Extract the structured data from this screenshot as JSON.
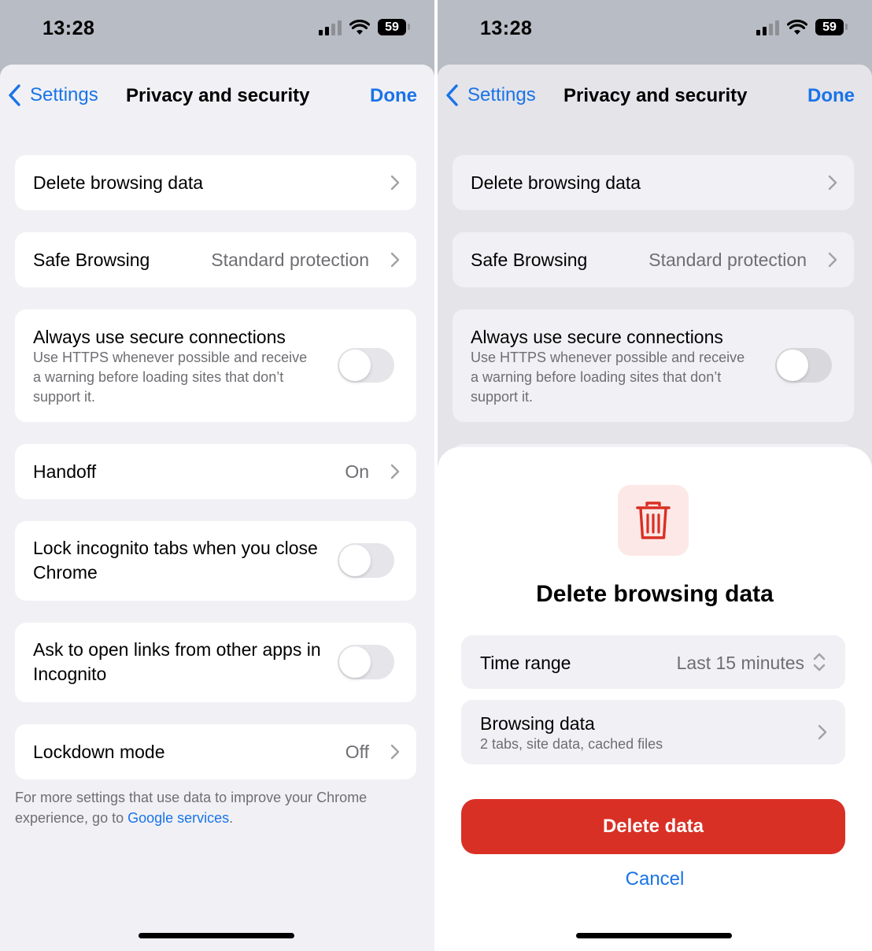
{
  "status": {
    "time": "13:28",
    "battery": "59"
  },
  "nav": {
    "back_label": "Settings",
    "title": "Privacy and security",
    "done_label": "Done"
  },
  "settings": {
    "delete_browsing_data": "Delete browsing data",
    "safe_browsing": {
      "label": "Safe Browsing",
      "value": "Standard protection"
    },
    "secure_connections": {
      "label": "Always use secure connections",
      "description": "Use HTTPS whenever possible and receive a warning before loading sites that don’t support it.",
      "enabled": false
    },
    "handoff": {
      "label": "Handoff",
      "value": "On"
    },
    "lock_incognito": {
      "label": "Lock incognito tabs when you close Chrome",
      "enabled": false
    },
    "ask_open_links": {
      "label": "Ask to open links from other apps in Incognito",
      "enabled": false
    },
    "lockdown_mode": {
      "label": "Lockdown mode",
      "value": "Off"
    }
  },
  "footer": {
    "text": "For more settings that use data to improve your Chrome experience, go to ",
    "link_label": "Google services",
    "suffix": "."
  },
  "dialog": {
    "icon": "trash-icon",
    "title": "Delete browsing data",
    "time_range": {
      "label": "Time range",
      "value": "Last 15 minutes"
    },
    "browsing_data": {
      "label": "Browsing data",
      "summary": "2 tabs, site data, cached files"
    },
    "delete_label": "Delete data",
    "cancel_label": "Cancel"
  },
  "colors": {
    "accent": "#1a73e8",
    "danger": "#d93025",
    "danger_bg": "#fce8e6",
    "background": "#f1f1f5"
  }
}
